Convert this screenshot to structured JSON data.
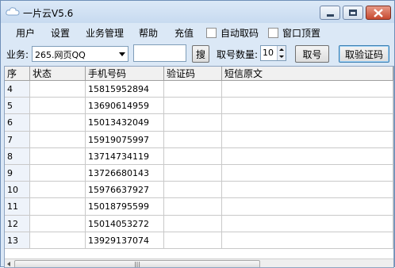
{
  "window": {
    "title": "一片云V5.6",
    "controls": {
      "minimize": "minimize",
      "maximize": "maximize",
      "close": "close"
    },
    "colors": {
      "titlebar": "#dce9f7",
      "close_button": "#c74a30",
      "frame": "#dbe8f6"
    }
  },
  "menubar": {
    "items": [
      "用户",
      "设置",
      "业务管理",
      "帮助",
      "充值"
    ],
    "checkboxes": [
      {
        "label": "自动取码",
        "checked": false
      },
      {
        "label": "窗口顶置",
        "checked": false
      }
    ]
  },
  "toolbar": {
    "business_label": "业务:",
    "business_selected": "265.网页QQ",
    "text_value": "",
    "search_button": "搜",
    "quantity_label": "取号数量:",
    "quantity_value": "10",
    "get_number_button": "取号",
    "get_code_button": "取验证码"
  },
  "grid": {
    "columns": [
      "序",
      "状态",
      "手机号码",
      "验证码",
      "短信原文"
    ],
    "rows": [
      {
        "seq": "4",
        "status": "",
        "phone": "15815952894",
        "code": "",
        "sms": ""
      },
      {
        "seq": "5",
        "status": "",
        "phone": "13690614959",
        "code": "",
        "sms": ""
      },
      {
        "seq": "6",
        "status": "",
        "phone": "15013432049",
        "code": "",
        "sms": ""
      },
      {
        "seq": "7",
        "status": "",
        "phone": "15919075997",
        "code": "",
        "sms": ""
      },
      {
        "seq": "8",
        "status": "",
        "phone": "13714734119",
        "code": "",
        "sms": ""
      },
      {
        "seq": "9",
        "status": "",
        "phone": "13726680143",
        "code": "",
        "sms": ""
      },
      {
        "seq": "10",
        "status": "",
        "phone": "15976637927",
        "code": "",
        "sms": ""
      },
      {
        "seq": "11",
        "status": "",
        "phone": "15018795599",
        "code": "",
        "sms": ""
      },
      {
        "seq": "12",
        "status": "",
        "phone": "15014053272",
        "code": "",
        "sms": ""
      },
      {
        "seq": "13",
        "status": "",
        "phone": "13929137074",
        "code": "",
        "sms": ""
      }
    ],
    "scrollbar_thumb_glyph": "|||"
  }
}
